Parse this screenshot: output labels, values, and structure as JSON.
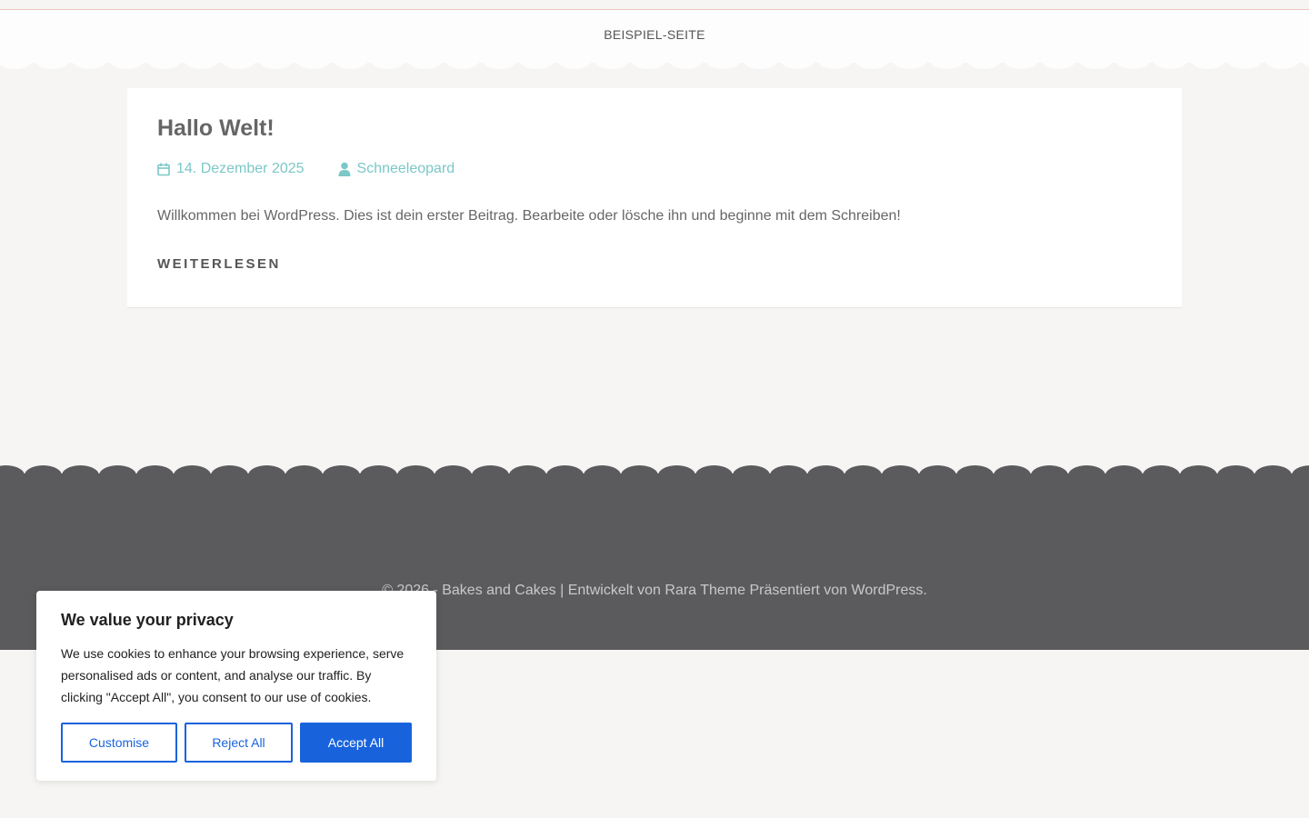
{
  "nav": {
    "items": [
      {
        "label": "Beispiel-Seite"
      }
    ]
  },
  "post": {
    "title": "Hallo Welt!",
    "date": "14. Dezember 2025",
    "author": "Schneeleopard",
    "excerpt": "Willkommen bei WordPress. Dies ist dein erster Beitrag. Bearbeite oder lösche ihn und beginne mit dem Schreiben!",
    "read_more": "Weiterlesen"
  },
  "footer": {
    "copyright": "© 2026 - Bakes and Cakes | Entwickelt von Rara Theme Präsentiert von WordPress."
  },
  "cookie_banner": {
    "title": "We value your privacy",
    "text": "We use cookies to enhance your browsing experience, serve personalised ads or content, and analyse our traffic. By clicking \"Accept All\", you consent to our use of cookies.",
    "customise_label": "Customise",
    "reject_label": "Reject All",
    "accept_label": "Accept All"
  },
  "colors": {
    "accent": "#7cc7c7",
    "footer_bg": "#5b5a5d",
    "cookie_button": "#1863dc",
    "page_bg": "#f6f5f3"
  },
  "icons": {
    "date": "calendar-icon",
    "author": "user-icon"
  }
}
